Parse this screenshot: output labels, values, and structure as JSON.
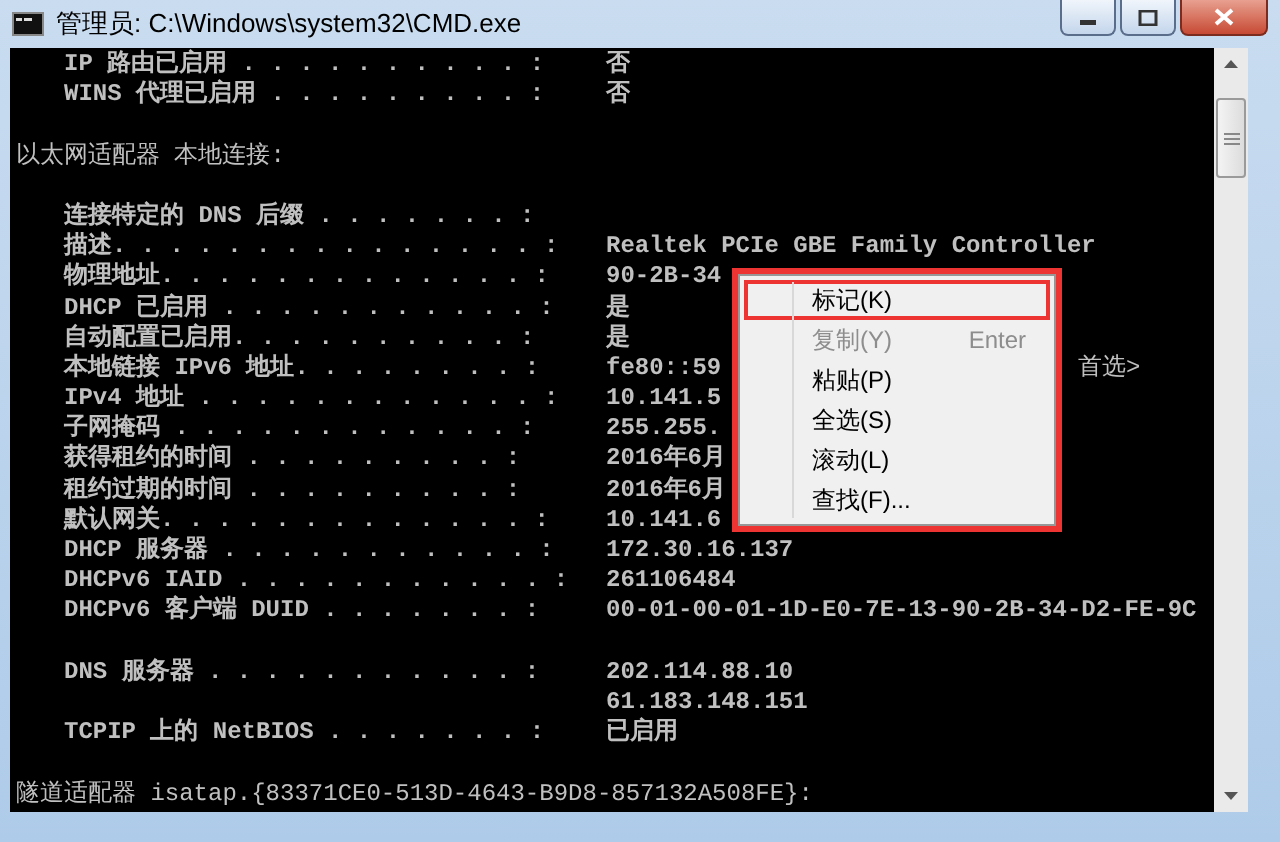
{
  "window": {
    "title": "管理员: C:\\Windows\\system32\\CMD.exe"
  },
  "console": {
    "lines": [
      {
        "kind": "field",
        "label": "IP 路由已启用 . . . . . . . . . . :",
        "value": "否"
      },
      {
        "kind": "field",
        "label": "WINS 代理已启用 . . . . . . . . . :",
        "value": "否"
      },
      {
        "kind": "blank"
      },
      {
        "kind": "heading",
        "text": "以太网适配器 本地连接:"
      },
      {
        "kind": "blank"
      },
      {
        "kind": "field",
        "label": "连接特定的 DNS 后缀 . . . . . . . :"
      },
      {
        "kind": "field",
        "label": "描述. . . . . . . . . . . . . . . :",
        "value": "Realtek PCIe GBE Family Controller"
      },
      {
        "kind": "field",
        "label": "物理地址. . . . . . . . . . . . . :",
        "value": "90-2B-34"
      },
      {
        "kind": "field",
        "label": "DHCP 已启用 . . . . . . . . . . . :",
        "value": "是"
      },
      {
        "kind": "field",
        "label": "自动配置已启用. . . . . . . . . . :",
        "value": "是"
      },
      {
        "kind": "field",
        "label": "本地链接 IPv6 地址. . . . . . . . :",
        "value": "fe80::59",
        "tail": "首选>"
      },
      {
        "kind": "field",
        "label": "IPv4 地址 . . . . . . . . . . . . :",
        "value": "10.141.5"
      },
      {
        "kind": "field",
        "label": "子网掩码 . . . . . . . . . . . . :",
        "value": "255.255."
      },
      {
        "kind": "field",
        "label": "获得租约的时间 . . . . . . . . . :",
        "value": "2016年6月"
      },
      {
        "kind": "field",
        "label": "租约过期的时间 . . . . . . . . . :",
        "value": "2016年6月"
      },
      {
        "kind": "field",
        "label": "默认网关. . . . . . . . . . . . . :",
        "value": "10.141.6"
      },
      {
        "kind": "field",
        "label": "DHCP 服务器 . . . . . . . . . . . :",
        "value": "172.30.16.137"
      },
      {
        "kind": "field",
        "label": "DHCPv6 IAID . . . . . . . . . . . :",
        "value": "261106484"
      },
      {
        "kind": "field",
        "label": "DHCPv6 客户端 DUID . . . . . . . :",
        "value": "00-01-00-01-1D-E0-7E-13-90-2B-34-D2-FE-9C"
      },
      {
        "kind": "blank"
      },
      {
        "kind": "field",
        "label": "DNS 服务器 . . . . . . . . . . . :",
        "value": "202.114.88.10"
      },
      {
        "kind": "field",
        "value": "61.183.148.151"
      },
      {
        "kind": "field",
        "label": "TCPIP 上的 NetBIOS . . . . . . . :",
        "value": "已启用"
      },
      {
        "kind": "blank"
      },
      {
        "kind": "heading",
        "text": "隧道适配器 isatap.{83371CE0-513D-4643-B9D8-857132A508FE}:"
      }
    ]
  },
  "context_menu": {
    "outlined": true,
    "items": [
      {
        "label": "标记(K)",
        "disabled": false,
        "outlined": true
      },
      {
        "label": "复制(Y)",
        "shortcut": "Enter",
        "disabled": true,
        "outlined": false
      },
      {
        "label": "粘贴(P)",
        "disabled": false,
        "outlined": false
      },
      {
        "label": "全选(S)",
        "disabled": false,
        "outlined": false
      },
      {
        "label": "滚动(L)",
        "disabled": false,
        "outlined": false
      },
      {
        "label": "查找(F)...",
        "disabled": false,
        "outlined": false
      }
    ]
  }
}
